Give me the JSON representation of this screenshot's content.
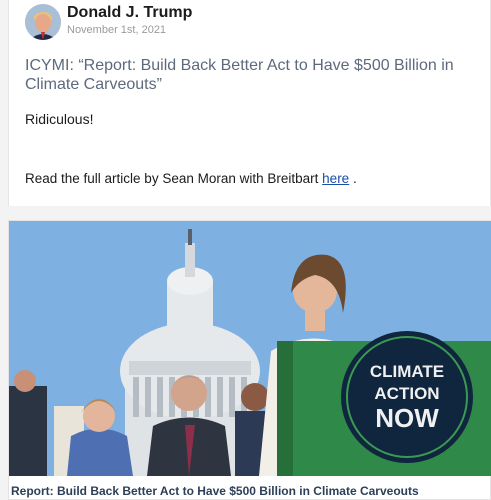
{
  "post": {
    "author": "Donald J. Trump",
    "date": "November 1st, 2021",
    "title": "ICYMI: “Report: Build Back Better Act to Have $500 Billion in Climate Carveouts”",
    "body": "Ridiculous!",
    "read_prefix": "Read the full article by Sean Moran with Breitbart",
    "read_link": "here",
    "read_suffix": " ."
  },
  "article": {
    "sign_line1": "CLIMATE",
    "sign_line2": "ACTION",
    "sign_line3": "NOW",
    "caption": "Report: Build Back Better Act to Have $500 Billion in Climate Carveouts"
  },
  "colors": {
    "title": "#5d6a7c",
    "link": "#1a4ea8",
    "caption": "#2c3f57",
    "sign_bg": "#10253e",
    "sky": "#7fb0e2"
  },
  "icons": {
    "avatar": "author-avatar-photo"
  }
}
